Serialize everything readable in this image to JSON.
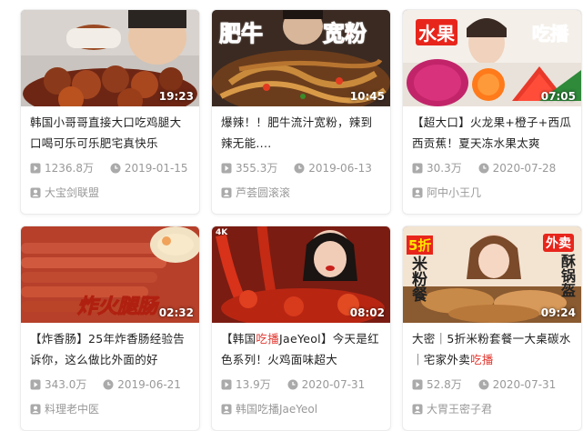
{
  "colors": {
    "accent": "#e3372f",
    "meta": "#999999",
    "title": "#222222"
  },
  "icons": {
    "views": "play-square-icon",
    "date": "clock-icon",
    "author": "user-icon"
  },
  "cards": [
    {
      "duration": "19:23",
      "title": "韩国小哥哥直接大口吃鸡腿大口喝可乐可乐肥宅真快乐",
      "views": "1236.8万",
      "date": "2019-01-15",
      "author": "大宝剑联盟",
      "thumb_texts": []
    },
    {
      "duration": "10:45",
      "title": "爆辣！！肥牛流汁宽粉，辣到辣无能....",
      "views": "355.3万",
      "date": "2019-06-13",
      "author": "芦荟圆滚滚",
      "thumb_texts": [
        "肥牛",
        "宽粉"
      ]
    },
    {
      "duration": "07:05",
      "title": "【超大口】火龙果+橙子+西瓜西贡蕉！夏天冻水果太爽",
      "views": "30.3万",
      "date": "2020-07-28",
      "author": "阿中小王几",
      "thumb_texts": [
        "水果",
        "吃播"
      ]
    },
    {
      "duration": "02:32",
      "title": "【炸香肠】25年炸香肠经验告诉你，这么做比外面的好",
      "views": "343.0万",
      "date": "2019-06-21",
      "author": "料理老中医",
      "thumb_texts": [
        "炸火腿肠"
      ]
    },
    {
      "duration": "08:02",
      "title_parts": [
        "【韩国",
        "吃播",
        "JaeYeol】今天是红色系列！火鸡面味超大"
      ],
      "views": "13.9万",
      "date": "2020-07-31",
      "author": "韩国吃播JaeYeol",
      "thumb_texts": [
        "4K"
      ]
    },
    {
      "duration": "09:24",
      "title_parts": [
        "大密｜5折米粉套餐一大桌碳水｜宅家外卖",
        "吃播",
        ""
      ],
      "views": "52.8万",
      "date": "2020-07-31",
      "author": "大胃王密子君",
      "thumb_texts": [
        "5折",
        "米粉餐",
        "外卖",
        "酥锅盔"
      ]
    }
  ]
}
